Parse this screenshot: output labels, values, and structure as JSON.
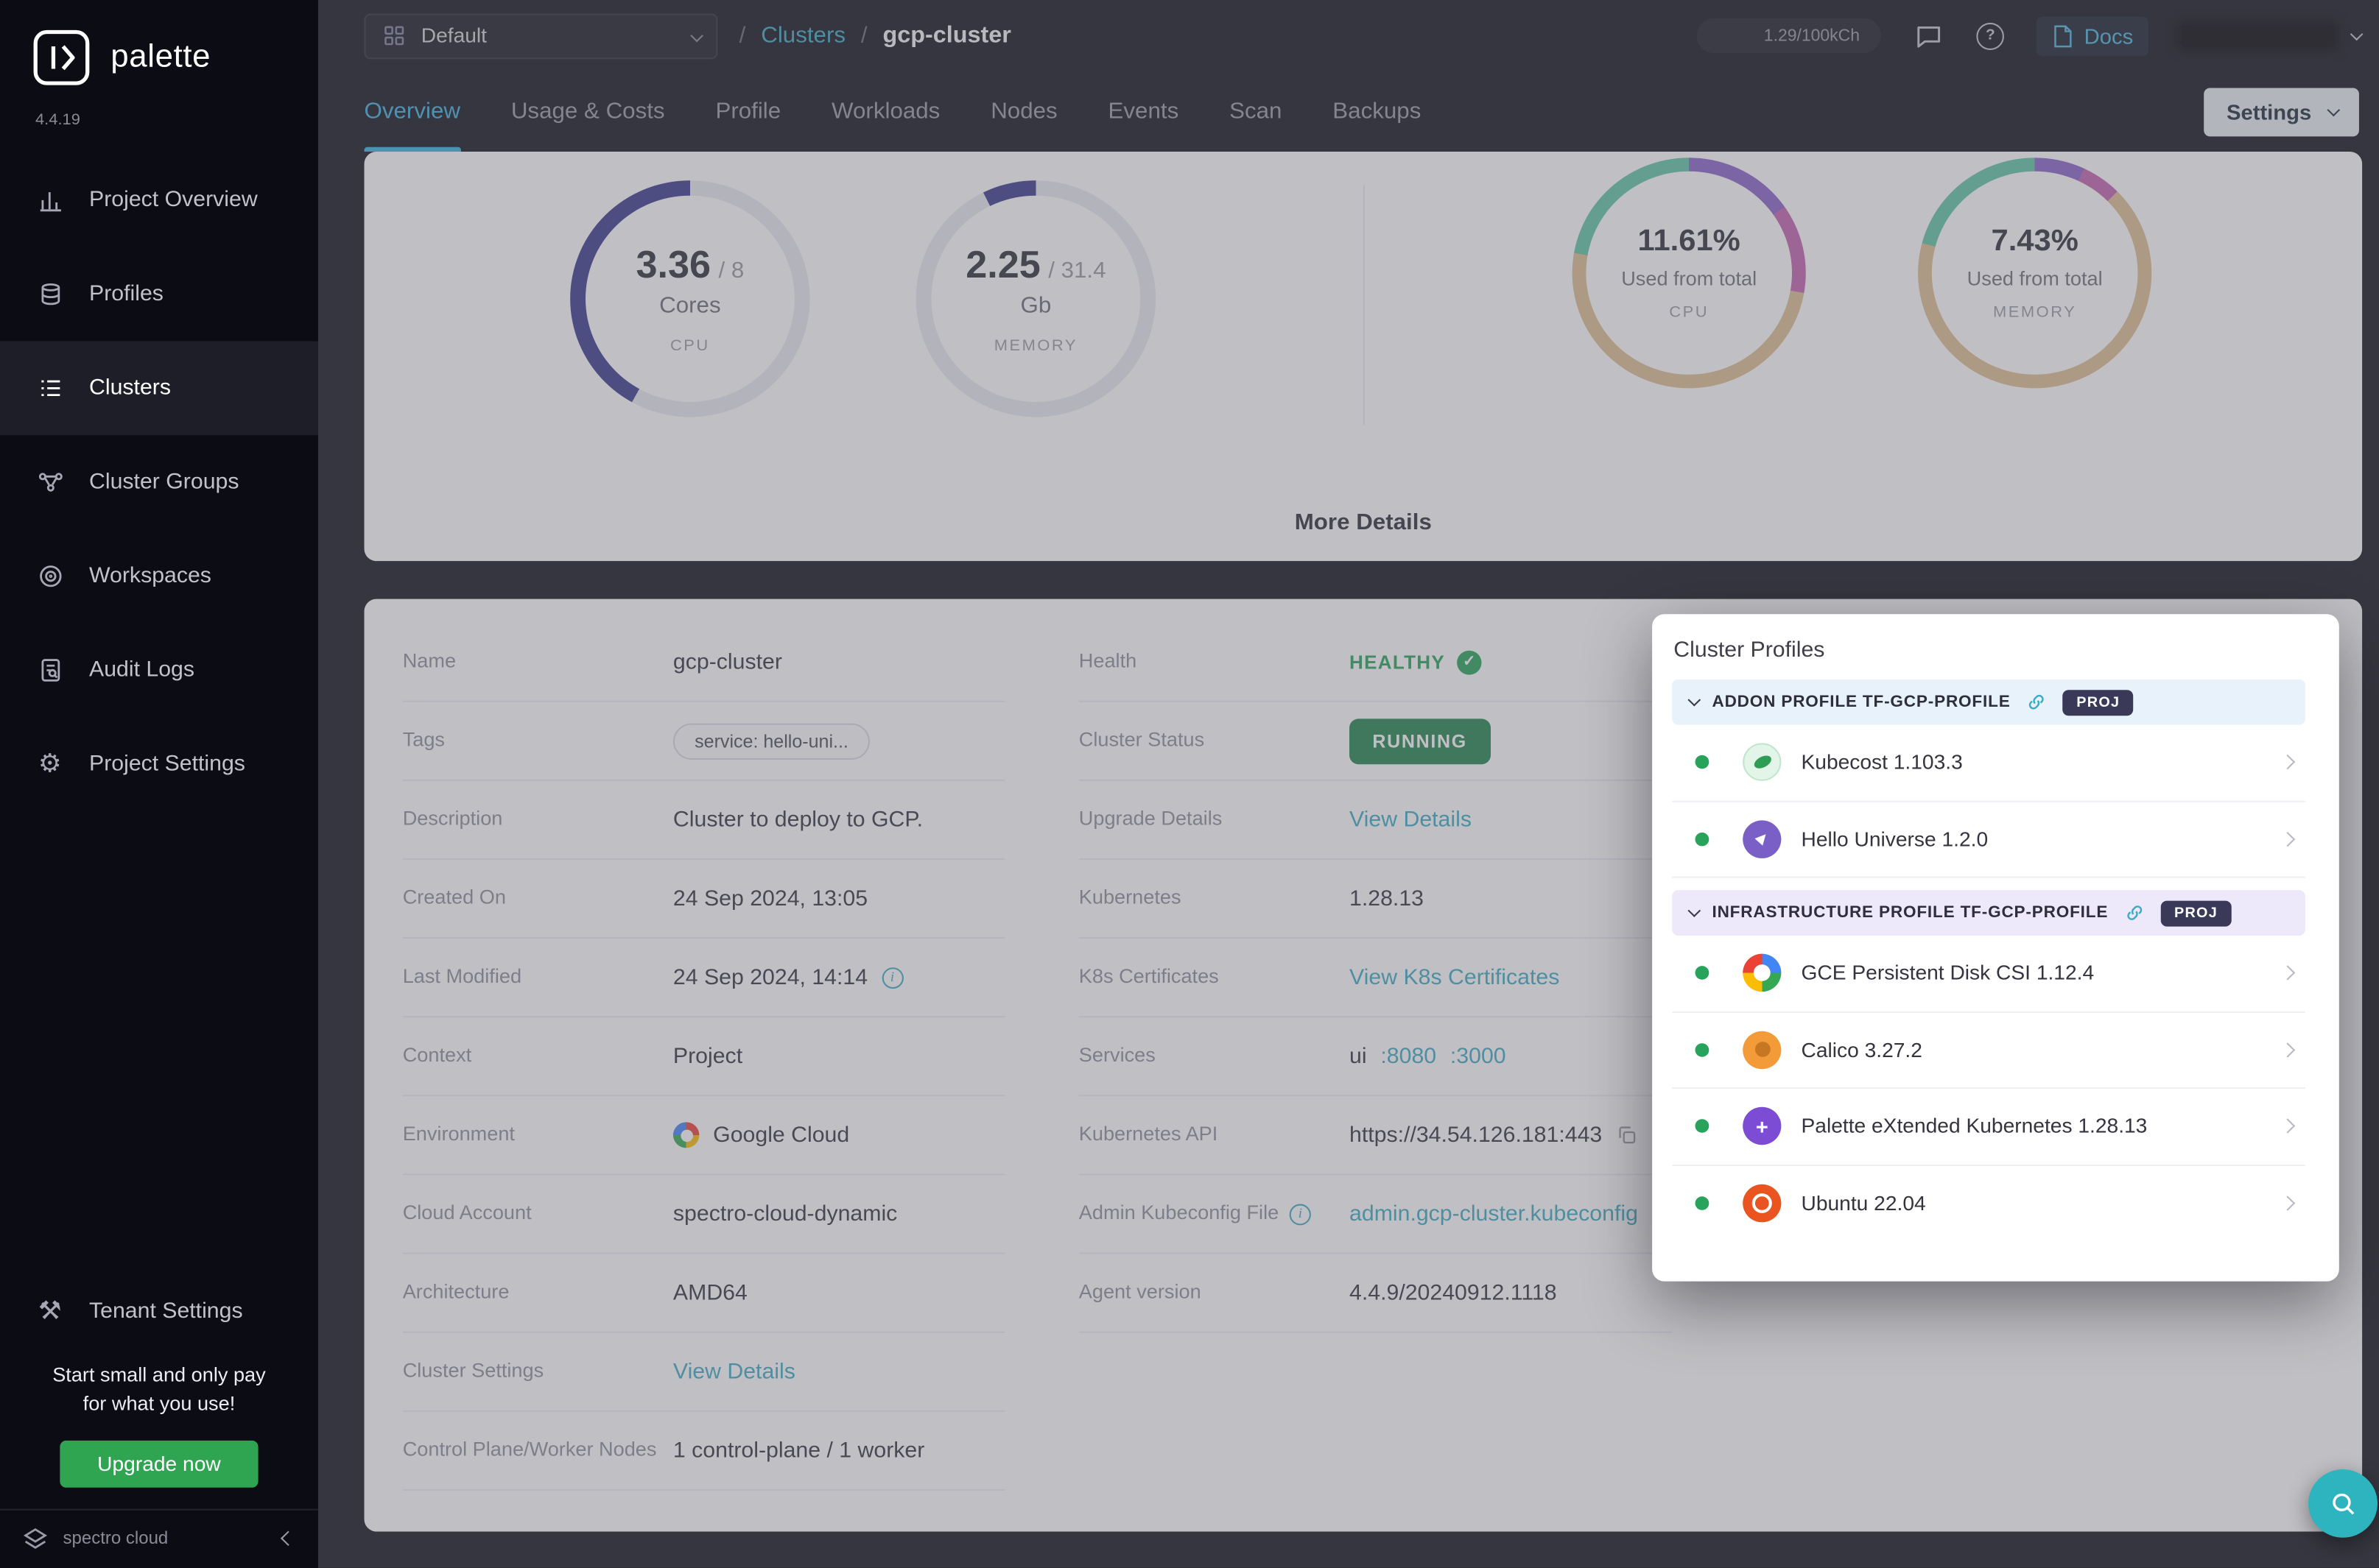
{
  "colors": {
    "accent": "#3BAAC2",
    "tabActive": "#41AEDC",
    "green": "#27A35B",
    "runningBg": "#21834D",
    "gauge": "#3A3A8C",
    "gaugeTrack": "#E8E8EF",
    "upgrade": "#2FA552"
  },
  "sidebar": {
    "brand": "palette",
    "version": "4.4.19",
    "items": [
      {
        "label": "Project Overview"
      },
      {
        "label": "Profiles"
      },
      {
        "label": "Clusters"
      },
      {
        "label": "Cluster Groups"
      },
      {
        "label": "Workspaces"
      },
      {
        "label": "Audit Logs"
      },
      {
        "label": "Project Settings"
      }
    ],
    "tenant": "Tenant Settings",
    "promo_line1": "Start small and only pay",
    "promo_line2": "for what you use!",
    "upgrade_label": "Upgrade now",
    "footer_brand": "spectro cloud"
  },
  "header": {
    "project_selector": "Default",
    "sep": "/",
    "breadcrumb_parent": "Clusters",
    "breadcrumb_current": "gcp-cluster",
    "usage_pill": "1.29/100kCh",
    "docs_label": "Docs"
  },
  "tabs": {
    "items": [
      "Overview",
      "Usage & Costs",
      "Profile",
      "Workloads",
      "Nodes",
      "Events",
      "Scan",
      "Backups"
    ],
    "settings_label": "Settings"
  },
  "stats": {
    "gauges": [
      {
        "value": "3.36",
        "total": "/ 8",
        "unit": "Cores",
        "label": "CPU",
        "fraction": 0.42
      },
      {
        "value": "2.25",
        "total": "/ 31.4",
        "unit": "Gb",
        "label": "MEMORY",
        "fraction": 0.072
      }
    ],
    "rings": [
      {
        "percent": "11.61%",
        "caption": "Used from total",
        "label": "CPU",
        "segments": [
          {
            "c": "#8A63C9",
            "d": 55
          },
          {
            "c": "#C263B0",
            "d": 45
          },
          {
            "c": "#DDBE92",
            "d": 180
          },
          {
            "c": "#5FC4A8",
            "d": 80
          }
        ]
      },
      {
        "percent": "7.43%",
        "caption": "Used from total",
        "label": "MEMORY",
        "segments": [
          {
            "c": "#8A63C9",
            "d": 25
          },
          {
            "c": "#C263B0",
            "d": 20
          },
          {
            "c": "#DDBE92",
            "d": 240
          },
          {
            "c": "#5FC4A8",
            "d": 75
          }
        ]
      }
    ],
    "more_details": "More Details"
  },
  "details": {
    "left": [
      {
        "label": "Name",
        "value": "gcp-cluster"
      },
      {
        "label": "Tags",
        "value": "service: hello-uni..."
      },
      {
        "label": "Description",
        "value": "Cluster to deploy to GCP."
      },
      {
        "label": "Created On",
        "value": "24 Sep 2024, 13:05"
      },
      {
        "label": "Last Modified",
        "value": "24 Sep 2024, 14:14"
      },
      {
        "label": "Context",
        "value": "Project"
      },
      {
        "label": "Environment",
        "value": "Google Cloud"
      },
      {
        "label": "Cloud Account",
        "value": "spectro-cloud-dynamic"
      },
      {
        "label": "Architecture",
        "value": "AMD64"
      },
      {
        "label": "Cluster Settings",
        "value": "View Details"
      },
      {
        "label": "Control Plane/Worker Nodes",
        "value": "1 control-plane / 1 worker"
      }
    ],
    "right": [
      {
        "label": "Health",
        "value": "HEALTHY"
      },
      {
        "label": "Cluster Status",
        "value": "RUNNING"
      },
      {
        "label": "Upgrade Details",
        "value": "View Details"
      },
      {
        "label": "Kubernetes",
        "value": "1.28.13"
      },
      {
        "label": "K8s Certificates",
        "value": "View K8s Certificates"
      },
      {
        "label": "Services",
        "value_prefix": "ui",
        "links": [
          ":8080",
          ":3000"
        ]
      },
      {
        "label": "Kubernetes API",
        "value": "https://34.54.126.181:443"
      },
      {
        "label": "Admin Kubeconfig File",
        "value": "admin.gcp-cluster.kubeconfig"
      },
      {
        "label": "Agent version",
        "value": "4.4.9/20240912.1118"
      }
    ]
  },
  "cluster_profiles": {
    "title": "Cluster Profiles",
    "sections": [
      {
        "name": "ADDON PROFILE TF-GCP-PROFILE",
        "badge": "PROJ",
        "items": [
          {
            "name": "Kubecost 1.103.3"
          },
          {
            "name": "Hello Universe 1.2.0"
          }
        ]
      },
      {
        "name": "INFRASTRUCTURE PROFILE TF-GCP-PROFILE",
        "badge": "PROJ",
        "items": [
          {
            "name": "GCE Persistent Disk CSI 1.12.4"
          },
          {
            "name": "Calico 3.27.2"
          },
          {
            "name": "Palette eXtended Kubernetes 1.28.13"
          },
          {
            "name": "Ubuntu 22.04"
          }
        ]
      }
    ]
  }
}
